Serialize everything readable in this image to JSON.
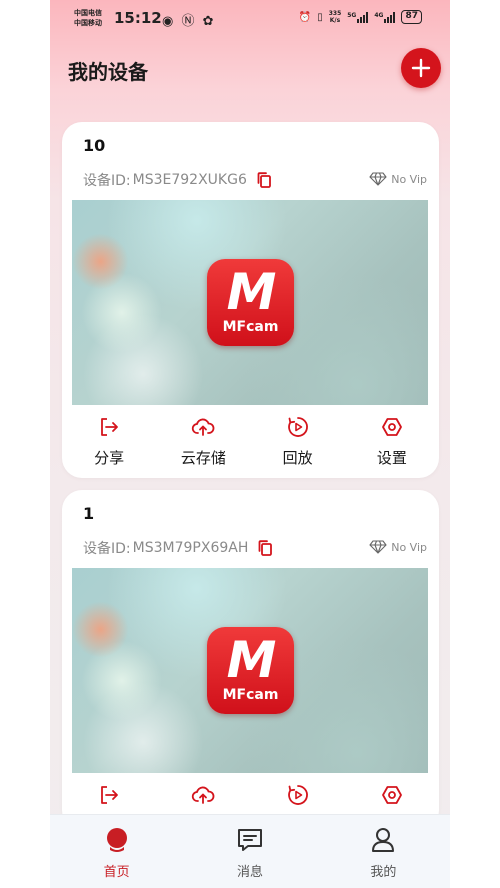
{
  "status_bar": {
    "carrier1": "中国电信",
    "carrier2": "中国移动",
    "time": "15:12",
    "speed_value": "335",
    "speed_unit": "K/s",
    "net1": "5G",
    "net2": "4G",
    "battery": "87"
  },
  "header": {
    "title": "我的设备"
  },
  "devices": [
    {
      "name": "10",
      "id_label": "设备ID:",
      "id": "MS3E792XUKG6",
      "vip": "No Vip",
      "logo_letter": "M",
      "logo_text": "MFcam"
    },
    {
      "name": "1",
      "id_label": "设备ID:",
      "id": "MS3M79PX69AH",
      "vip": "No Vip",
      "logo_letter": "M",
      "logo_text": "MFcam"
    }
  ],
  "actions": {
    "share": "分享",
    "cloud": "云存储",
    "playback": "回放",
    "settings": "设置"
  },
  "tabbar": {
    "home": "首页",
    "messages": "消息",
    "mine": "我的"
  },
  "colors": {
    "accent": "#d4141c",
    "header_gradient_top": "#fbb6bd"
  }
}
